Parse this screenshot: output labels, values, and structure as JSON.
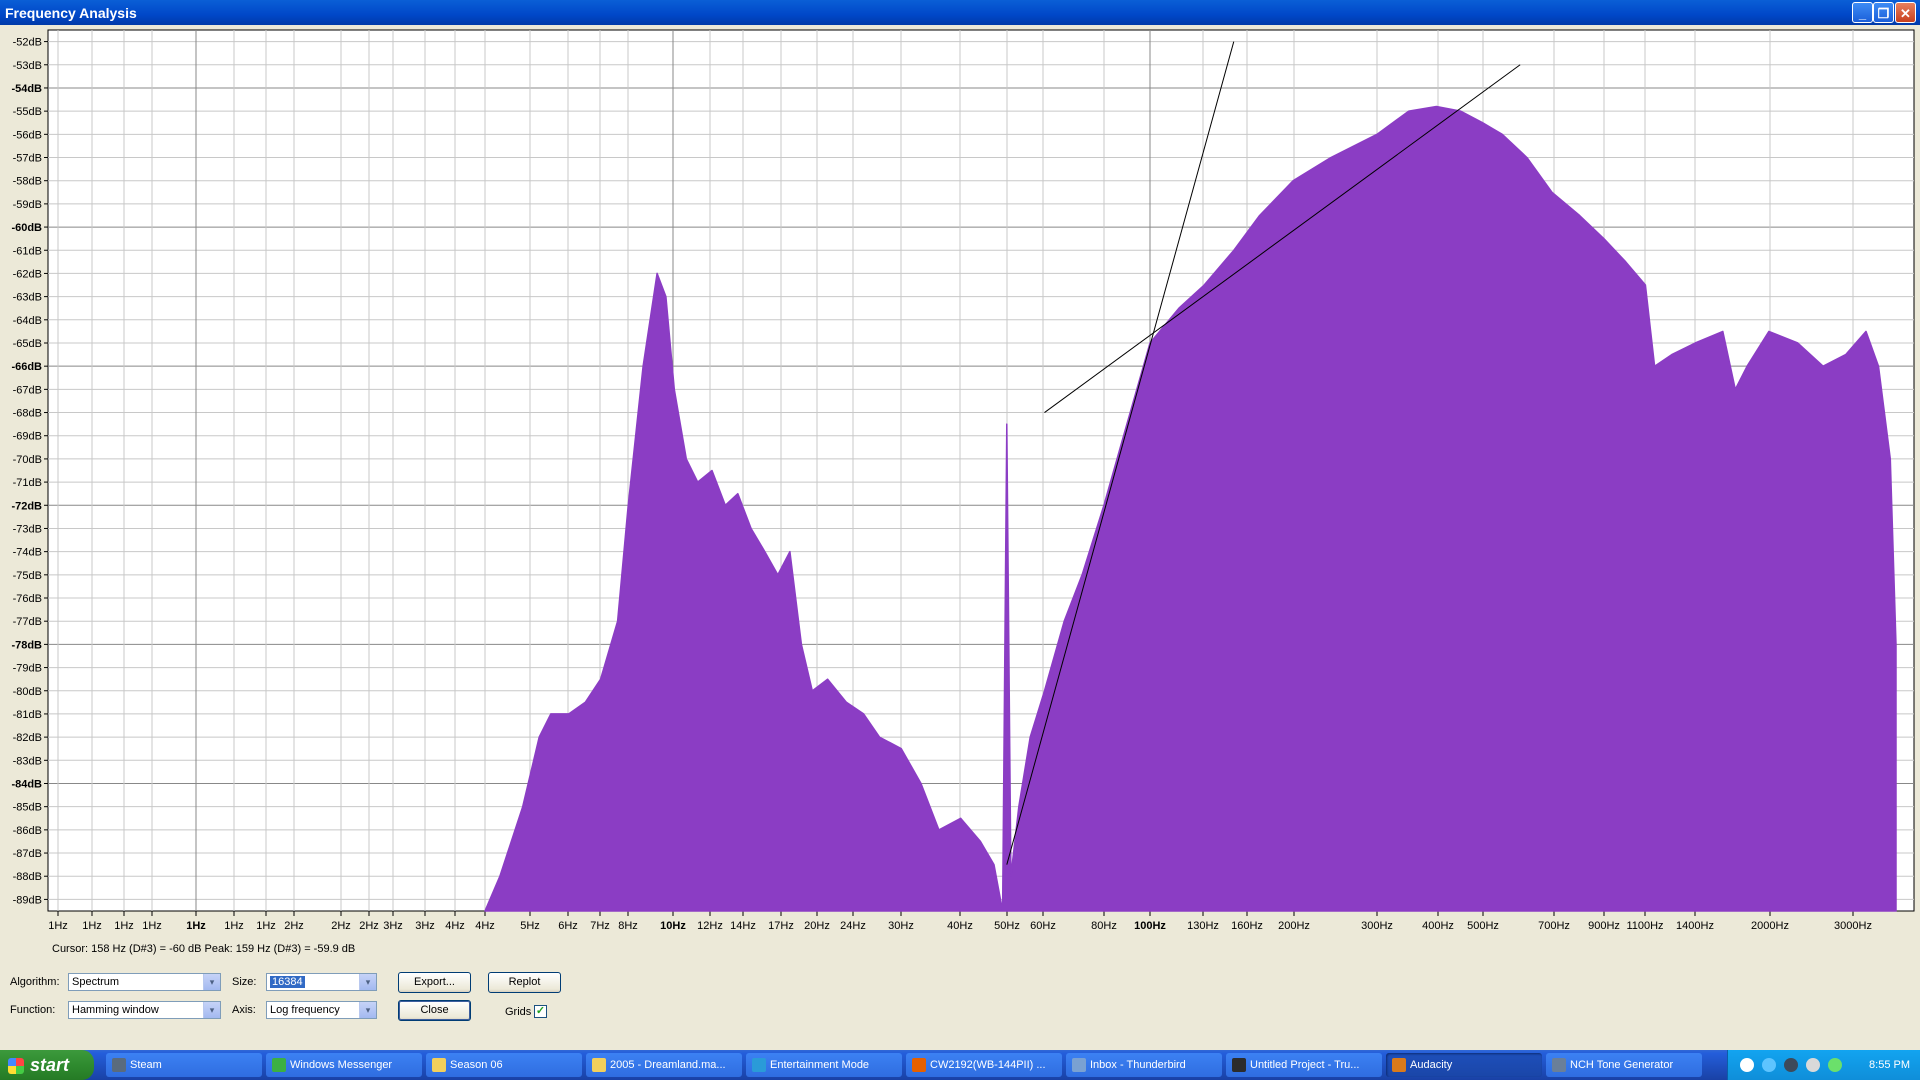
{
  "window": {
    "title": "Frequency Analysis"
  },
  "window_buttons": {
    "minimize": "_",
    "restore": "❐",
    "close": "✕"
  },
  "chart_data": {
    "type": "area",
    "title": "",
    "xlabel": "",
    "ylabel": "",
    "x_scale": "log",
    "fill_color": "#8b3dc4",
    "grid": true,
    "y_ticks": [
      "-52dB",
      "-53dB",
      "-54dB",
      "-55dB",
      "-56dB",
      "-57dB",
      "-58dB",
      "-59dB",
      "-60dB",
      "-61dB",
      "-62dB",
      "-63dB",
      "-64dB",
      "-65dB",
      "-66dB",
      "-67dB",
      "-68dB",
      "-69dB",
      "-70dB",
      "-71dB",
      "-72dB",
      "-73dB",
      "-74dB",
      "-75dB",
      "-76dB",
      "-77dB",
      "-78dB",
      "-79dB",
      "-80dB",
      "-81dB",
      "-82dB",
      "-83dB",
      "-84dB",
      "-85dB",
      "-86dB",
      "-87dB",
      "-88dB",
      "-89dB"
    ],
    "y_bold": [
      "-54dB",
      "-60dB",
      "-66dB",
      "-72dB",
      "-78dB",
      "-84dB"
    ],
    "x_ticks": [
      "1Hz",
      "1Hz",
      "1Hz",
      "1Hz",
      "1Hz",
      "1Hz",
      "1Hz",
      "2Hz",
      "2Hz",
      "2Hz",
      "3Hz",
      "3Hz",
      "4Hz",
      "4Hz",
      "5Hz",
      "6Hz",
      "7Hz",
      "8Hz",
      "10Hz",
      "12Hz",
      "14Hz",
      "17Hz",
      "20Hz",
      "24Hz",
      "30Hz",
      "40Hz",
      "50Hz",
      "60Hz",
      "80Hz",
      "100Hz",
      "130Hz",
      "160Hz",
      "200Hz",
      "300Hz",
      "400Hz",
      "500Hz",
      "700Hz",
      "900Hz",
      "1100Hz",
      "1400Hz",
      "2000Hz",
      "3000Hz"
    ],
    "x_bold": [
      "1Hz#4",
      "10Hz",
      "100Hz"
    ],
    "ylim": [
      -89.5,
      -51.5
    ],
    "series": [
      {
        "points": [
          [
            4,
            -89.5
          ],
          [
            4.3,
            -88
          ],
          [
            4.8,
            -85
          ],
          [
            5.2,
            -82
          ],
          [
            5.5,
            -81
          ],
          [
            6,
            -81
          ],
          [
            6.5,
            -80.5
          ],
          [
            7,
            -79.5
          ],
          [
            7.6,
            -77
          ],
          [
            8,
            -72
          ],
          [
            8.6,
            -66
          ],
          [
            9.2,
            -62
          ],
          [
            9.6,
            -63
          ],
          [
            10,
            -67
          ],
          [
            10.6,
            -70
          ],
          [
            11.2,
            -71
          ],
          [
            12,
            -70.5
          ],
          [
            12.8,
            -72
          ],
          [
            13.6,
            -71.5
          ],
          [
            14.5,
            -73
          ],
          [
            15.5,
            -74
          ],
          [
            16.5,
            -75
          ],
          [
            17.5,
            -74
          ],
          [
            18.5,
            -78
          ],
          [
            19.5,
            -80
          ],
          [
            21,
            -79.5
          ],
          [
            23,
            -80.5
          ],
          [
            25,
            -81
          ],
          [
            27,
            -82
          ],
          [
            30,
            -82.5
          ],
          [
            33,
            -84
          ],
          [
            36,
            -86
          ],
          [
            40,
            -85.5
          ],
          [
            44,
            -86.5
          ],
          [
            47,
            -87.5
          ],
          [
            49,
            -89.5
          ],
          [
            50,
            -68.5
          ],
          [
            51,
            -88
          ],
          [
            53,
            -85
          ],
          [
            56,
            -82
          ],
          [
            60,
            -80
          ],
          [
            66,
            -77
          ],
          [
            72,
            -75
          ],
          [
            80,
            -72
          ],
          [
            88,
            -69
          ],
          [
            100,
            -65
          ],
          [
            115,
            -63.5
          ],
          [
            130,
            -62.5
          ],
          [
            150,
            -61
          ],
          [
            170,
            -59.5
          ],
          [
            200,
            -58
          ],
          [
            240,
            -57
          ],
          [
            300,
            -56
          ],
          [
            350,
            -55
          ],
          [
            400,
            -54.8
          ],
          [
            450,
            -55
          ],
          [
            500,
            -55.5
          ],
          [
            550,
            -56
          ],
          [
            620,
            -57
          ],
          [
            700,
            -58.5
          ],
          [
            800,
            -59.5
          ],
          [
            900,
            -60.5
          ],
          [
            1000,
            -61.5
          ],
          [
            1100,
            -62.5
          ],
          [
            1150,
            -66
          ],
          [
            1250,
            -65.5
          ],
          [
            1400,
            -65
          ],
          [
            1600,
            -64.5
          ],
          [
            1700,
            -67
          ],
          [
            1800,
            -66
          ],
          [
            2000,
            -64.5
          ],
          [
            2300,
            -65
          ],
          [
            2600,
            -66
          ],
          [
            2900,
            -65.5
          ],
          [
            3200,
            -64.5
          ],
          [
            3400,
            -66
          ],
          [
            3600,
            -70
          ],
          [
            3700,
            -78
          ]
        ]
      }
    ],
    "trend_lines": [
      {
        "points": [
          [
            50,
            -87.5
          ],
          [
            150,
            -52
          ]
        ]
      },
      {
        "points": [
          [
            60,
            -68
          ],
          [
            600,
            -53
          ]
        ]
      }
    ]
  },
  "status": {
    "cursor_peak": "Cursor: 158 Hz (D#3) = -60 dB    Peak: 159 Hz (D#3) = -59.9 dB"
  },
  "controls": {
    "algorithm_label": "Algorithm:",
    "algorithm_value": "Spectrum",
    "size_label": "Size:",
    "size_value": "16384",
    "function_label": "Function:",
    "function_value": "Hamming window",
    "axis_label": "Axis:",
    "axis_value": "Log frequency",
    "export_button": "Export...",
    "replot_button": "Replot",
    "close_button": "Close",
    "grids_label": "Grids",
    "grids_checked": "✓",
    "combo_arrow": "▾"
  },
  "taskbar": {
    "start_label": "start",
    "tasks": [
      {
        "label": "Steam",
        "icon": "steam-icon",
        "color": "#5a6b7d"
      },
      {
        "label": "Windows Messenger",
        "icon": "messenger-icon",
        "color": "#3cb043"
      },
      {
        "label": "Season 06",
        "icon": "folder-icon",
        "color": "#f2cf5b"
      },
      {
        "label": "2005 - Dreamland.ma...",
        "icon": "folder-icon",
        "color": "#f2cf5b"
      },
      {
        "label": "Entertainment Mode",
        "icon": "app-icon",
        "color": "#2a9bd8"
      },
      {
        "label": "CW2192(WB-144PII) ...",
        "icon": "firefox-icon",
        "color": "#e66000"
      },
      {
        "label": "Inbox - Thunderbird",
        "icon": "thunderbird-icon",
        "color": "#7aa1d2"
      },
      {
        "label": "Untitled Project - Tru...",
        "icon": "audio-app-icon",
        "color": "#2c2c2c"
      },
      {
        "label": "Audacity",
        "icon": "audacity-icon",
        "color": "#d97a1b"
      },
      {
        "label": "NCH Tone Generator",
        "icon": "tone-generator-icon",
        "color": "#6a7f99"
      }
    ],
    "clock": "8:55 PM"
  }
}
